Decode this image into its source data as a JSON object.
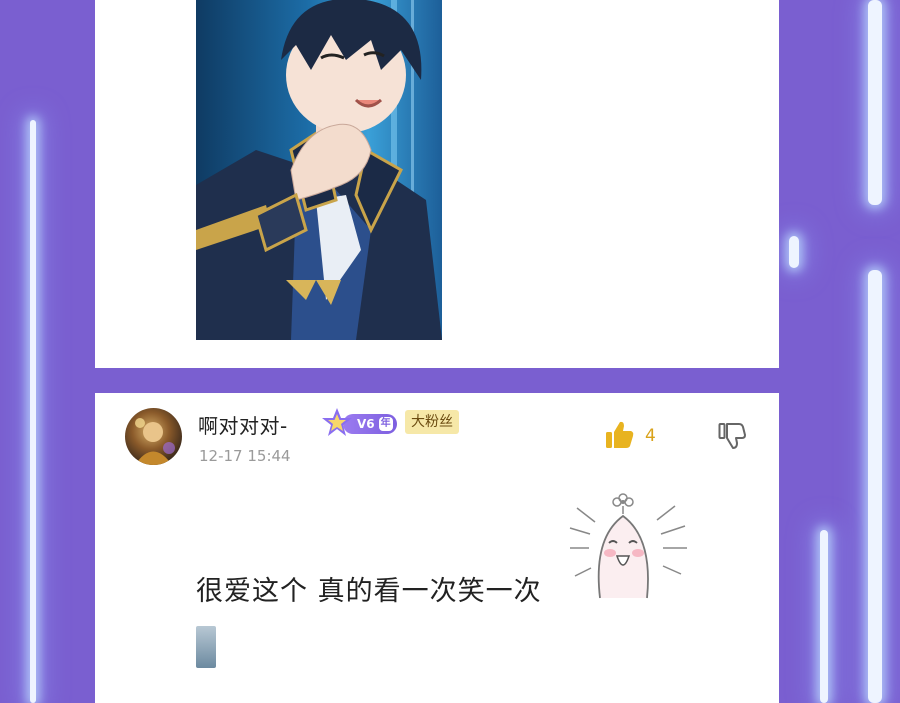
{
  "comment": {
    "username": "啊对对对-",
    "vip_level": "V6",
    "vip_year": "年",
    "fan_badge": "大粉丝",
    "timestamp": "12-17 15:44",
    "like_count": "4",
    "text": "很爱这个 真的看一次笑一次"
  },
  "icons": {
    "like": "thumbs-up-icon",
    "dislike": "thumbs-down-icon",
    "vip": "star-crown-icon"
  },
  "colors": {
    "background": "#7a5fd0",
    "like_accent": "#e8b320",
    "fan_badge_bg": "#f6e8a8",
    "vip_accent": "#8a6ef0"
  }
}
